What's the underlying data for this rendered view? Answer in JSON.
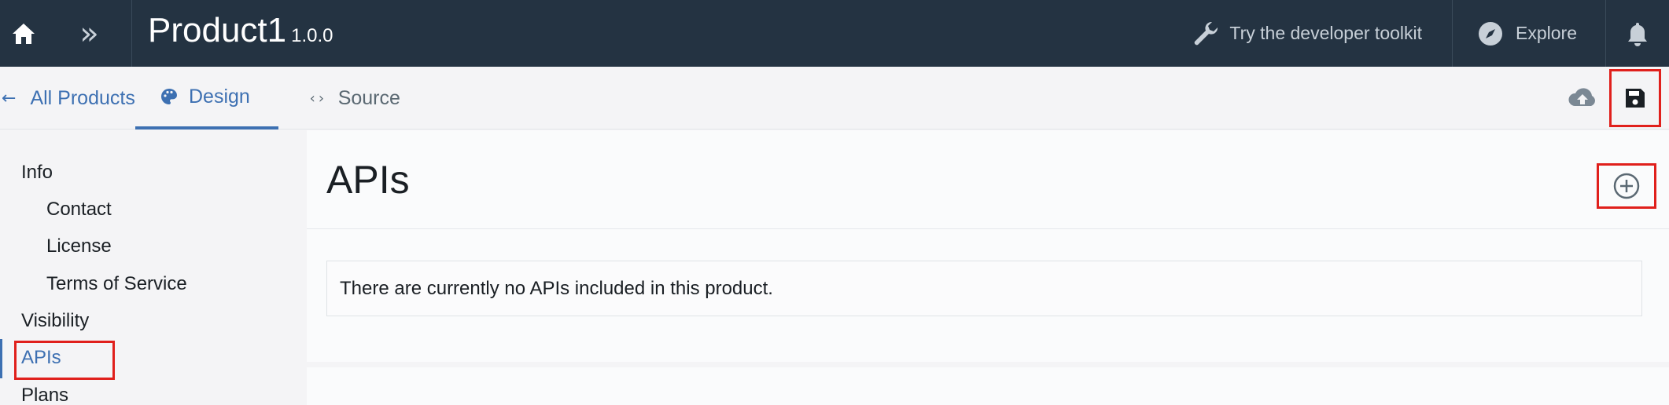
{
  "topbar": {
    "product_name": "Product1",
    "version": "1.0.0",
    "toolkit_label": "Try the developer toolkit",
    "explore_label": "Explore",
    "expand_glyph": "»",
    "icons": [
      "home-icon",
      "expand-icon",
      "wrench-icon",
      "compass-icon",
      "bell-icon"
    ]
  },
  "subbar": {
    "back_label": "All Products",
    "back_arrow": "←",
    "tabs": [
      {
        "label": "Design",
        "icon": "palette-icon",
        "active": true
      },
      {
        "label": "Source",
        "icon": "code-icon",
        "active": false
      }
    ],
    "source_glyph": "‹›",
    "actions": [
      "upload-cloud-icon",
      "save-icon"
    ]
  },
  "nav": {
    "items": [
      {
        "label": "Info",
        "level": 0
      },
      {
        "label": "Contact",
        "level": 1
      },
      {
        "label": "License",
        "level": 1
      },
      {
        "label": "Terms of Service",
        "level": 1
      },
      {
        "label": "Visibility",
        "level": 0
      },
      {
        "label": "APIs",
        "level": 0,
        "active": true
      },
      {
        "label": "Plans",
        "level": 0
      }
    ]
  },
  "main": {
    "title": "APIs",
    "empty_message": "There are currently no APIs included in this product.",
    "add_icon": "add-circle-icon"
  },
  "colors": {
    "topbar_bg": "#243342",
    "accent": "#3d70b2",
    "highlight_box": "#e0201c"
  }
}
